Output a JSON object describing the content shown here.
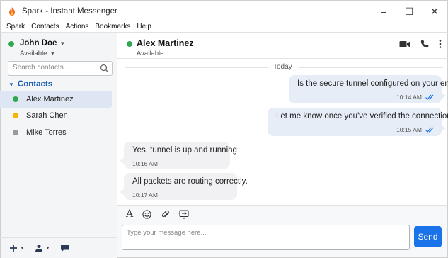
{
  "window": {
    "title": "Spark - Instant Messenger",
    "app_icon": "flame-icon",
    "controls": {
      "minimize": "–",
      "maximize": "☐",
      "close": "✕"
    }
  },
  "menubar": {
    "items": [
      {
        "label": "Spark"
      },
      {
        "label": "Contacts"
      },
      {
        "label": "Actions"
      },
      {
        "label": "Bookmarks"
      },
      {
        "label": "Help"
      }
    ]
  },
  "profile": {
    "name": "John Doe",
    "status": "Available",
    "status_color": "#2fa84f"
  },
  "search": {
    "placeholder": "Search contacts..."
  },
  "contacts": {
    "group_label": "Contacts",
    "items": [
      {
        "name": "Alex Martinez",
        "status_color": "#2fa84f",
        "selected": true
      },
      {
        "name": "Sarah Chen",
        "status_color": "#f5b400",
        "selected": false
      },
      {
        "name": "Mike Torres",
        "status_color": "#9a9a9a",
        "selected": false
      }
    ]
  },
  "chat": {
    "peer_name": "Alex Martinez",
    "peer_status": "Available",
    "day_label": "Today",
    "messages": [
      {
        "direction": "out",
        "text": "Is the secure tunnel configured on your end?",
        "time": "10:14 AM",
        "read": true
      },
      {
        "direction": "out",
        "text": "Let me know once you've verified the connection.",
        "time": "10:15 AM",
        "read": true
      },
      {
        "direction": "in",
        "text": "Yes, tunnel is up and running",
        "time": "10:16 AM"
      },
      {
        "direction": "in",
        "text": "All packets are routing correctly.",
        "time": "10:17 AM"
      }
    ]
  },
  "composer": {
    "format_label": "A",
    "placeholder": "Type your message here...",
    "send_label": "Send"
  },
  "colors": {
    "accent": "#1a73e8",
    "outgoing_bubble": "#e6edf7",
    "incoming_bubble": "#f1f1f3",
    "selected_row": "#dde6f2"
  }
}
